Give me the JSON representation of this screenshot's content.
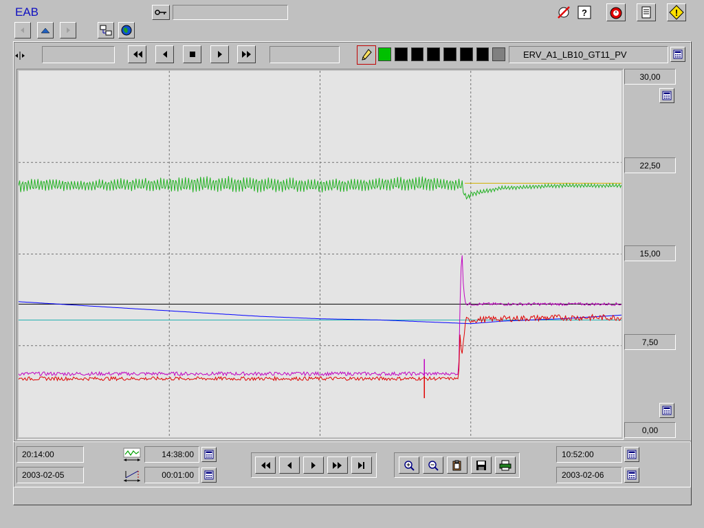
{
  "app": {
    "title": "EAB"
  },
  "toolbar": {
    "login_field": "",
    "plot_start_field": "",
    "plot_end_field": "",
    "tag_name": "ERV_A1_LB10_GT11_PV",
    "pen_colors": [
      "#00c000",
      "#000000",
      "#000000",
      "#000000",
      "#000000",
      "#000000",
      "#000000",
      "#808080"
    ]
  },
  "icons": {
    "back": "back-arrow-icon",
    "up": "up-arrow-icon",
    "forward": "forward-arrow-icon",
    "network": "network-icon",
    "globe": "globe-icon",
    "key": "key-icon",
    "no_alarm": "alarm-off-icon",
    "help": "help-icon",
    "alarm": "alarm-clock-icon",
    "notes": "notepad-icon",
    "warning": "warning-icon",
    "pen": "pen-icon",
    "calculator": "calculator-icon",
    "rewind": "rewind-icon",
    "step_back": "step-back-icon",
    "stop": "stop-icon",
    "play": "play-icon",
    "fast_forward": "fast-forward-icon",
    "to_end": "skip-to-end-icon",
    "zoom_in": "zoom-in-icon",
    "zoom_out": "zoom-out-icon",
    "clipboard": "clipboard-icon",
    "save": "save-icon",
    "print": "print-icon",
    "span": "time-span-icon",
    "interval": "interval-icon"
  },
  "chart_data": {
    "type": "line",
    "ylim": [
      0,
      30
    ],
    "y_ticks": [
      "30,00",
      "22,50",
      "15,00",
      "7,50",
      "0,00"
    ],
    "grid": true,
    "x_gridlines": 4,
    "background": "#e4e4e4",
    "reference_lines": [
      {
        "color": "#d0b000",
        "y": 20.8,
        "x_start": 0.74,
        "x_end": 1.0
      },
      {
        "color": "#000000",
        "y": 10.9,
        "x_start": 0.0,
        "x_end": 1.0
      },
      {
        "color": "#20b0b0",
        "y": 9.6,
        "x_start": 0.0,
        "x_end": 1.0
      }
    ],
    "series": [
      {
        "color": "#20b020",
        "x": [
          0,
          0.05,
          0.1,
          0.2,
          0.3,
          0.4,
          0.5,
          0.6,
          0.67,
          0.7,
          0.735,
          0.74,
          0.745,
          0.75,
          0.8,
          0.9,
          1.0
        ],
        "y": [
          20.6,
          20.7,
          20.6,
          20.7,
          20.7,
          20.7,
          20.6,
          20.7,
          20.8,
          20.7,
          20.7,
          19.8,
          19.6,
          19.9,
          20.4,
          20.6,
          20.6
        ],
        "osc": [
          0.5,
          0.5,
          0.4,
          0.5,
          0.6,
          0.6,
          0.5,
          0.5,
          0.6,
          0.5,
          0.5,
          0.2,
          0.2,
          0.2,
          0.15,
          0.15,
          0.15
        ]
      },
      {
        "color": "#0000ff",
        "x": [
          0,
          0.1,
          0.2,
          0.3,
          0.4,
          0.5,
          0.6,
          0.7,
          0.75,
          0.8,
          0.9,
          1.0
        ],
        "y": [
          11.1,
          10.8,
          10.5,
          10.2,
          9.9,
          9.7,
          9.6,
          9.4,
          9.3,
          9.5,
          9.7,
          10.0
        ],
        "osc": [
          0,
          0,
          0,
          0,
          0,
          0,
          0,
          0,
          0,
          0,
          0,
          0
        ]
      },
      {
        "color": "#c000c0",
        "x": [
          0,
          0.3,
          0.6,
          0.675,
          0.73,
          0.732,
          0.735,
          0.738,
          0.742,
          0.75,
          0.8,
          0.9,
          1.0
        ],
        "y": [
          5.2,
          5.2,
          5.2,
          5.2,
          5.2,
          10.5,
          15.8,
          12.0,
          10.9,
          10.9,
          10.9,
          10.9,
          10.9
        ],
        "osc": [
          0.15,
          0.15,
          0.15,
          0.15,
          0.1,
          0,
          0,
          0,
          0.12,
          0.12,
          0.12,
          0.12,
          0.12
        ]
      },
      {
        "color": "#e00000",
        "x": [
          0,
          0.3,
          0.6,
          0.675,
          0.73,
          0.732,
          0.735,
          0.738,
          0.742,
          0.75,
          0.8,
          0.9,
          1.0
        ],
        "y": [
          4.8,
          4.8,
          4.8,
          4.8,
          4.8,
          8.5,
          6.5,
          8.0,
          9.6,
          9.6,
          9.7,
          9.8,
          9.8
        ],
        "osc": [
          0.15,
          0.15,
          0.15,
          0.15,
          0.1,
          0,
          0,
          0,
          0.25,
          0.25,
          0.25,
          0.25,
          0.25
        ]
      }
    ],
    "spikes": [
      {
        "color": "#c000c0",
        "x": 0.673,
        "y_top": 6.4,
        "y_bottom": 4.6
      },
      {
        "color": "#e00000",
        "x": 0.673,
        "y_top": 5.0,
        "y_bottom": 3.2
      }
    ]
  },
  "bottom": {
    "start_time": "20:14:00",
    "start_date": "2003-02-05",
    "span": "14:38:00",
    "interval": "00:01:00",
    "end_time": "10:52:00",
    "end_date": "2003-02-06"
  }
}
